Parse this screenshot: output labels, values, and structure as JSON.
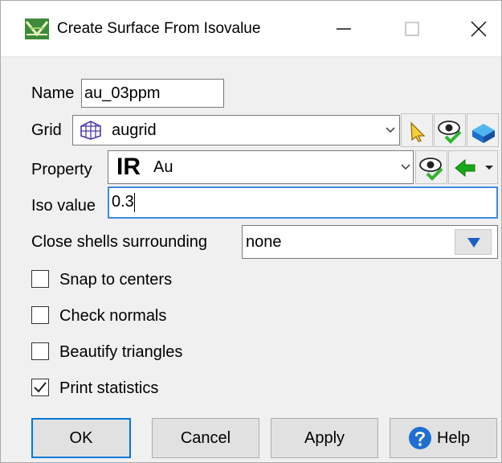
{
  "window": {
    "title": "Create Surface From Isovalue",
    "minimize_icon": "minimize-icon",
    "maximize_icon": "maximize-icon",
    "close_icon": "close-icon"
  },
  "form": {
    "name": {
      "label": "Name",
      "value": "au_03ppm"
    },
    "grid": {
      "label": "Grid",
      "value": "augrid",
      "icon": "grid-mesh-icon"
    },
    "property": {
      "label": "Property",
      "value": "Au",
      "type_badge": "IR"
    },
    "iso_value": {
      "label": "Iso value",
      "value": "0.3"
    },
    "close_shells": {
      "label": "Close shells surrounding",
      "value": "none"
    }
  },
  "options": [
    {
      "label": "Snap to centers",
      "checked": false
    },
    {
      "label": "Check normals",
      "checked": false
    },
    {
      "label": "Beautify triangles",
      "checked": false
    },
    {
      "label": "Print statistics",
      "checked": true
    }
  ],
  "buttons": {
    "ok": "OK",
    "cancel": "Cancel",
    "apply": "Apply",
    "help": "Help"
  },
  "colors": {
    "accent": "#0078d7",
    "focus_border": "#3c8be0",
    "eye_green": "#2fb52f",
    "arrow_green": "#18a818",
    "help_blue": "#1e6fd0"
  }
}
